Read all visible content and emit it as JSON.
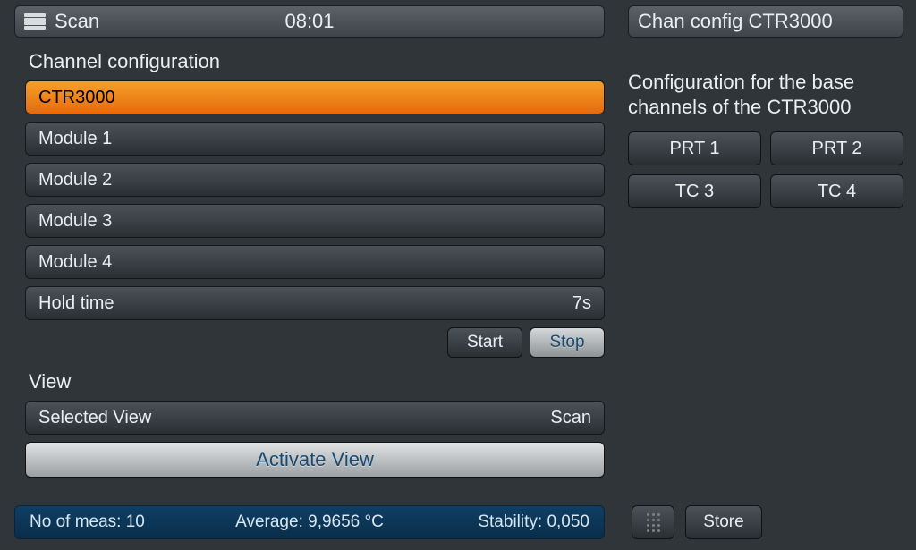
{
  "topbar": {
    "scan_label": "Scan",
    "time": "08:01",
    "right_label": "Chan config CTR3000"
  },
  "channel_config": {
    "title": "Channel configuration",
    "rows": [
      {
        "label": "CTR3000",
        "selected": true
      },
      {
        "label": "Module 1"
      },
      {
        "label": "Module 2"
      },
      {
        "label": "Module 3"
      },
      {
        "label": "Module 4"
      },
      {
        "label": "Hold time",
        "value": "7s"
      }
    ],
    "start_label": "Start",
    "stop_label": "Stop"
  },
  "view": {
    "title": "View",
    "row_label": "Selected View",
    "row_value": "Scan",
    "activate_label": "Activate View"
  },
  "right_panel": {
    "title_line1": "Configuration for the base",
    "title_line2": "channels of the CTR3000",
    "buttons": [
      "PRT 1",
      "PRT 2",
      "TC 3",
      "TC 4"
    ]
  },
  "status": {
    "meas_label": "No of meas: 10",
    "avg_label": "Average: 9,9656 °C",
    "stab_label": "Stability: 0,050"
  },
  "bottom": {
    "store_label": "Store"
  }
}
